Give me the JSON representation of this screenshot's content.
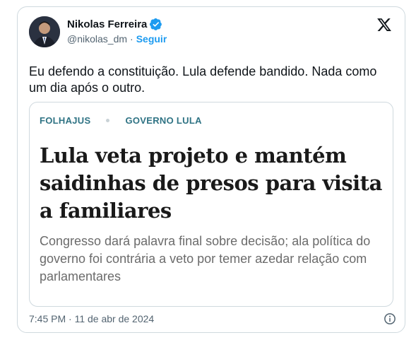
{
  "author": {
    "name": "Nikolas Ferreira",
    "handle": "@nikolas_dm",
    "separator": "·",
    "follow_label": "Seguir"
  },
  "tweet": {
    "text": "Eu defendo a constituição. Lula defende bandido. Nada como um dia após o outro."
  },
  "article": {
    "tag1": "FOLHAJUS",
    "tag2": "GOVERNO LULA",
    "headline": "Lula veta projeto e mantém saidinhas de presos para visita a familiares",
    "subhead": "Congresso dará palavra final sobre decisão; ala política do governo foi contrária a veto por temer azedar relação com parlamentares"
  },
  "footer": {
    "timestamp": "7:45 PM · 11 de abr de 2024"
  },
  "icons": {
    "verified": "verified-badge-icon",
    "brand": "x-logo-icon",
    "info": "info-icon"
  },
  "colors": {
    "accent": "#1d9bf0",
    "tag": "#2f7384",
    "text": "#0f1419",
    "muted": "#536471"
  }
}
